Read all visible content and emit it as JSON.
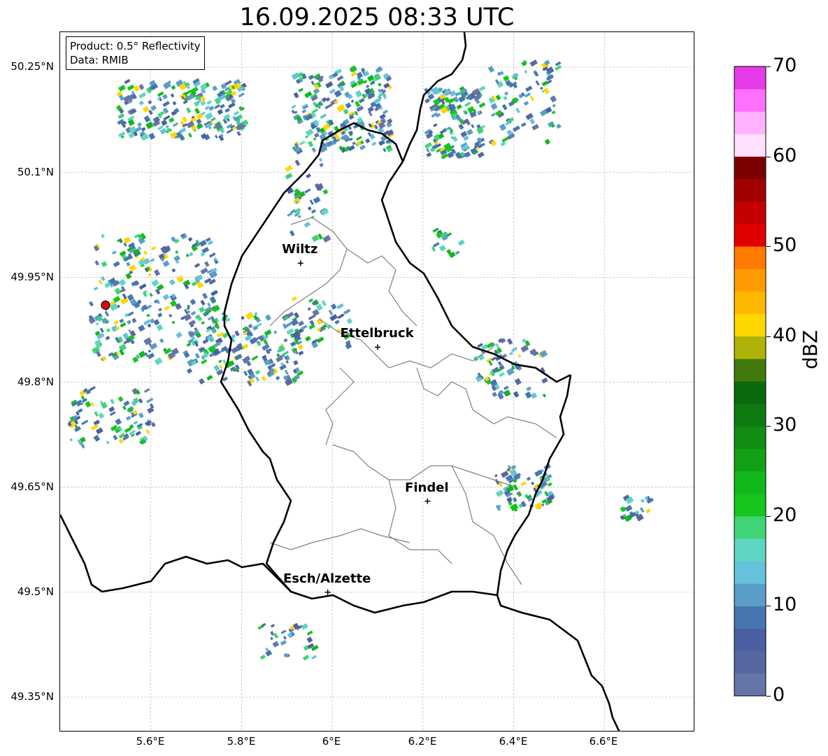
{
  "title": "16.09.2025 08:33 UTC",
  "info_box": {
    "product": "Product: 0.5° Reflectivity",
    "data": "Data: RMIB"
  },
  "axes": {
    "lat_ticks": [
      "50.25°N",
      "50.1°N",
      "49.95°N",
      "49.8°N",
      "49.65°N",
      "49.5°N",
      "49.35°N"
    ],
    "lon_ticks": [
      "5.6°E",
      "5.8°E",
      "6°E",
      "6.2°E",
      "6.4°E",
      "6.6°E"
    ],
    "grid": true,
    "lon_range": [
      5.4,
      6.8
    ],
    "lat_range": [
      49.3,
      50.3
    ]
  },
  "cities": [
    {
      "name": "Wiltz",
      "lon": 5.93,
      "lat": 49.97
    },
    {
      "name": "Ettelbruck",
      "lon": 6.1,
      "lat": 49.85
    },
    {
      "name": "Findel",
      "lon": 6.21,
      "lat": 49.63
    },
    {
      "name": "Esch/Alzette",
      "lon": 5.99,
      "lat": 49.5
    }
  ],
  "radar_site": {
    "lon": 5.5,
    "lat": 49.91,
    "color": "#e0001a"
  },
  "colorbar": {
    "label": "dBZ",
    "ticks": [
      "0",
      "10",
      "20",
      "30",
      "40",
      "50",
      "60",
      "70"
    ],
    "min": 0,
    "max": 70,
    "colors": [
      "#6675a8",
      "#5768a0",
      "#4a60a3",
      "#4775b0",
      "#5a9ec7",
      "#67c1db",
      "#5fd6c2",
      "#3fd476",
      "#16c61c",
      "#12b71b",
      "#12a017",
      "#118d14",
      "#0e7a10",
      "#0a6a0e",
      "#447a0c",
      "#adb307",
      "#ffd700",
      "#ffb800",
      "#ff9b00",
      "#ff7b00",
      "#e00000",
      "#c40000",
      "#a30000",
      "#7d0000",
      "#ffe0ff",
      "#ffb3ff",
      "#ff70ff",
      "#e83be8"
    ]
  },
  "colors": {
    "border": "#000000",
    "cantons": "#808080",
    "grid": "#bbbbbb"
  }
}
